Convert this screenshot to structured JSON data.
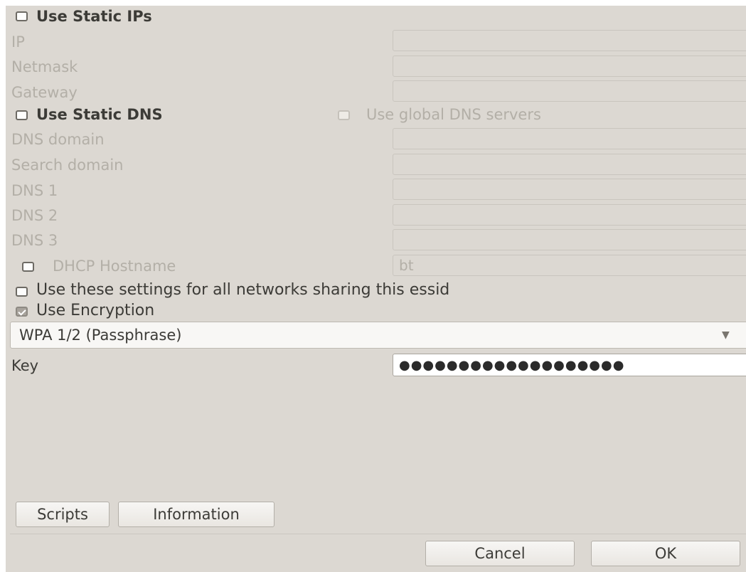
{
  "static_ip": {
    "checkbox_label": "Use Static IPs",
    "checked": false,
    "fields": [
      {
        "label": "IP",
        "value": ""
      },
      {
        "label": "Netmask",
        "value": ""
      },
      {
        "label": "Gateway",
        "value": ""
      }
    ]
  },
  "static_dns": {
    "checkbox_label": "Use Static DNS",
    "checked": false,
    "global_dns_label": "Use global DNS servers",
    "global_dns_checked": false,
    "fields": [
      {
        "label": "DNS domain",
        "value": ""
      },
      {
        "label": "Search domain",
        "value": ""
      },
      {
        "label": "DNS 1",
        "value": ""
      },
      {
        "label": "DNS 2",
        "value": ""
      },
      {
        "label": "DNS 3",
        "value": ""
      }
    ]
  },
  "dhcp": {
    "label": "DHCP Hostname",
    "checked": false,
    "value": "bt"
  },
  "essid_settings": {
    "label": "Use these settings for all networks sharing this essid",
    "checked": false
  },
  "encryption": {
    "label": "Use Encryption",
    "checked": true,
    "type_selected": "WPA 1/2 (Passphrase)",
    "key_label": "Key",
    "key_value": "●●●●●●●●●●●●●●●●●●●"
  },
  "buttons": {
    "scripts": "Scripts",
    "information": "Information",
    "cancel": "Cancel",
    "ok": "OK"
  },
  "icons": {
    "dropdown": "chevron-down-icon"
  }
}
